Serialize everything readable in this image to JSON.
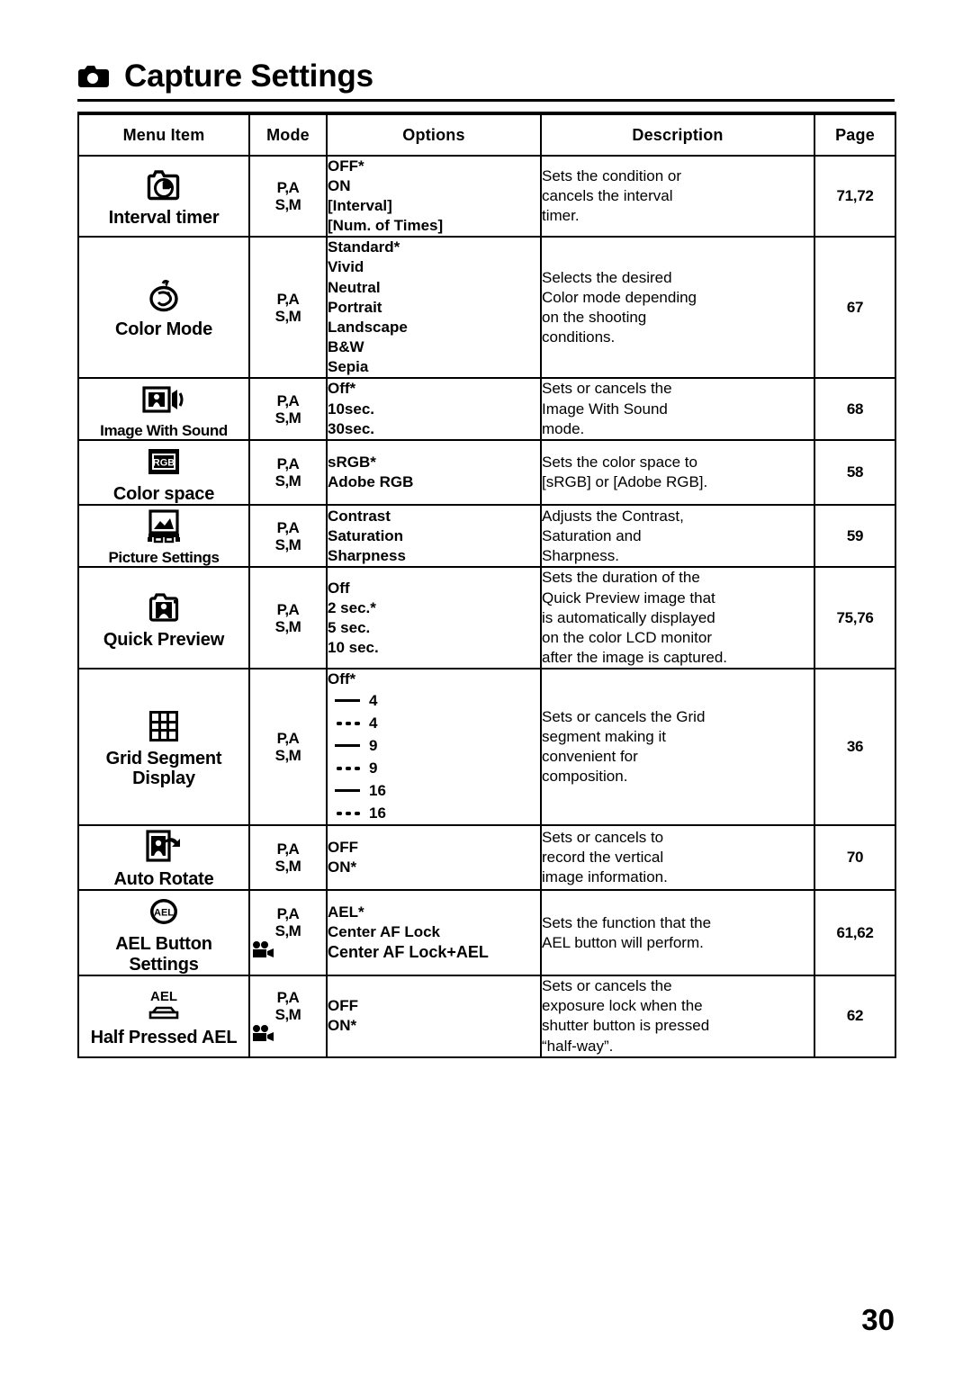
{
  "header": {
    "title": "Capture Settings",
    "icon": "camera-icon"
  },
  "table": {
    "columns": [
      "Menu Item",
      "Mode",
      "Options",
      "Description",
      "Page"
    ],
    "rows": [
      {
        "icon": "interval-timer-icon",
        "menu_item": "Interval timer",
        "mode": [
          "P,A",
          "S,M"
        ],
        "movie_mode": false,
        "options": [
          "OFF*",
          "ON",
          "[Interval]",
          "[Num. of Times]"
        ],
        "description": [
          "Sets the condition or",
          "cancels the interval",
          "timer."
        ],
        "page": "71,72"
      },
      {
        "icon": "color-mode-icon",
        "menu_item": "Color Mode",
        "mode": [
          "P,A",
          "S,M"
        ],
        "movie_mode": false,
        "options": [
          "Standard*",
          "Vivid",
          "Neutral",
          "Portrait",
          "Landscape",
          "B&W",
          "Sepia"
        ],
        "description": [
          "Selects the desired",
          "Color mode depending",
          "on the shooting",
          "conditions."
        ],
        "page": "67"
      },
      {
        "icon": "image-with-sound-icon",
        "menu_item": "Image With Sound",
        "mode": [
          "P,A",
          "S,M"
        ],
        "movie_mode": false,
        "options": [
          "Off*",
          "10sec.",
          "30sec."
        ],
        "description": [
          "Sets or cancels the",
          "Image With Sound",
          "mode."
        ],
        "page": "68"
      },
      {
        "icon": "rgb-color-space-icon",
        "menu_item": "Color space",
        "mode": [
          "P,A",
          "S,M"
        ],
        "movie_mode": false,
        "options": [
          "sRGB*",
          "Adobe RGB"
        ],
        "description": [
          "Sets the color space to",
          "[sRGB] or [Adobe RGB]."
        ],
        "page": "58"
      },
      {
        "icon": "picture-settings-icon",
        "menu_item": "Picture Settings",
        "mode": [
          "P,A",
          "S,M"
        ],
        "movie_mode": false,
        "options": [
          "Contrast",
          "Saturation",
          "Sharpness"
        ],
        "description": [
          "Adjusts the Contrast,",
          "Saturation and",
          "Sharpness."
        ],
        "page": "59"
      },
      {
        "icon": "quick-preview-icon",
        "menu_item": "Quick Preview",
        "mode": [
          "P,A",
          "S,M"
        ],
        "movie_mode": false,
        "options": [
          "Off",
          "2 sec.*",
          "5 sec.",
          "10 sec."
        ],
        "description": [
          "Sets the duration of the",
          "Quick Preview image that",
          "is automatically displayed",
          "on the color LCD monitor",
          "after the image is captured."
        ],
        "page": "75,76"
      },
      {
        "icon": "grid-segment-icon",
        "menu_item": "Grid Segment Display",
        "mode": [
          "P,A",
          "S,M"
        ],
        "movie_mode": false,
        "options_grid": [
          {
            "line": "none",
            "value": "Off*"
          },
          {
            "line": "solid",
            "value": "4"
          },
          {
            "line": "dotted",
            "value": "4"
          },
          {
            "line": "solid",
            "value": "9"
          },
          {
            "line": "dotted",
            "value": "9"
          },
          {
            "line": "solid",
            "value": "16"
          },
          {
            "line": "dotted",
            "value": "16"
          }
        ],
        "description": [
          "Sets or cancels the Grid",
          "segment making it",
          "convenient for",
          "composition."
        ],
        "page": "36"
      },
      {
        "icon": "auto-rotate-icon",
        "menu_item": "Auto Rotate",
        "mode": [
          "P,A",
          "S,M"
        ],
        "movie_mode": false,
        "options": [
          "OFF",
          "ON*"
        ],
        "description": [
          "Sets or cancels to",
          "record the vertical",
          "image information."
        ],
        "page": "70"
      },
      {
        "icon": "ael-circle-icon",
        "menu_item": "AEL Button Settings",
        "mode": [
          "P,A",
          "S,M"
        ],
        "movie_mode": true,
        "options": [
          "AEL*",
          "Center AF Lock",
          "Center AF Lock+AEL"
        ],
        "description": [
          "Sets the function that the",
          "AEL button will perform."
        ],
        "page": "61,62"
      },
      {
        "icon": "half-pressed-ael-icon",
        "menu_item": "Half Pressed AEL",
        "mode": [
          "P,A",
          "S,M"
        ],
        "movie_mode": true,
        "options": [
          "OFF",
          "ON*"
        ],
        "description": [
          "Sets or cancels the",
          "exposure lock when the",
          "shutter button is pressed",
          "“half-way”."
        ],
        "page": "62"
      }
    ]
  },
  "footer": {
    "page_number": "30"
  }
}
